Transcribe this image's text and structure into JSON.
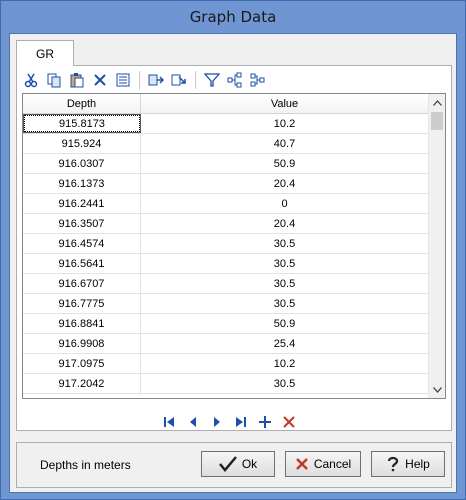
{
  "window": {
    "title": "Graph Data"
  },
  "tabs": [
    {
      "label": "GR"
    }
  ],
  "toolbar": {
    "icons": [
      "cut-icon",
      "copy-icon",
      "paste-icon",
      "delete-icon",
      "clear-icon",
      "copy-rows-icon",
      "paste-rows-icon",
      "filter-icon",
      "sort-icon",
      "group-icon"
    ]
  },
  "grid": {
    "columns": [
      "Depth",
      "Value"
    ],
    "rows": [
      [
        "915.8173",
        "10.2"
      ],
      [
        "915.924",
        "40.7"
      ],
      [
        "916.0307",
        "50.9"
      ],
      [
        "916.1373",
        "20.4"
      ],
      [
        "916.2441",
        "0"
      ],
      [
        "916.3507",
        "20.4"
      ],
      [
        "916.4574",
        "30.5"
      ],
      [
        "916.5641",
        "30.5"
      ],
      [
        "916.6707",
        "30.5"
      ],
      [
        "916.7775",
        "30.5"
      ],
      [
        "916.8841",
        "50.9"
      ],
      [
        "916.9908",
        "25.4"
      ],
      [
        "917.0975",
        "10.2"
      ],
      [
        "917.2042",
        "30.5"
      ]
    ]
  },
  "navigator": {
    "icons": [
      "first-record-icon",
      "prior-record-icon",
      "next-record-icon",
      "last-record-icon",
      "insert-record-icon",
      "delete-record-icon"
    ]
  },
  "status": {
    "text": "Depths in meters"
  },
  "buttons": {
    "ok": "Ok",
    "cancel": "Cancel",
    "help": "Help"
  },
  "colors": {
    "accent": "#1f4fa8",
    "delete": "#c0392b",
    "window_frame": "#6f95d2"
  }
}
